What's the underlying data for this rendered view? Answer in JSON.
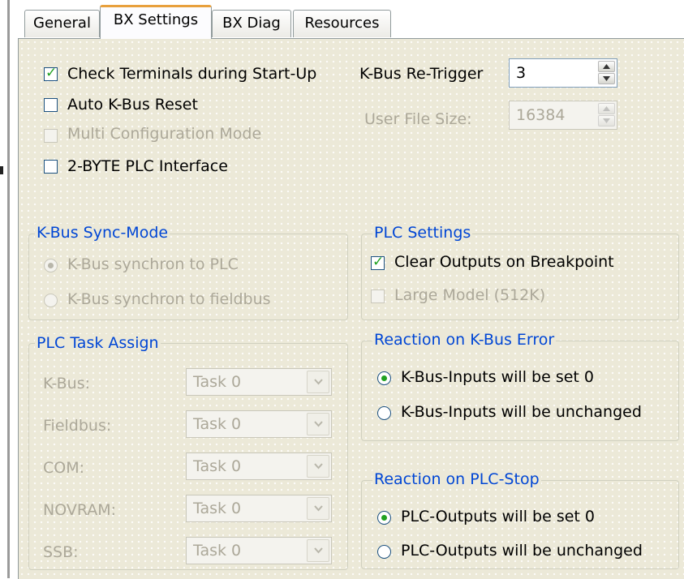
{
  "tabs": [
    "General",
    "BX Settings",
    "BX Diag",
    "Resources"
  ],
  "active_tab": "BX Settings",
  "checkboxes": {
    "check_terminals": {
      "label": "Check Terminals during Start-Up",
      "checked": true,
      "enabled": true
    },
    "auto_kbus_reset": {
      "label": "Auto K-Bus Reset",
      "checked": false,
      "enabled": true
    },
    "multi_config": {
      "label": "Multi Configuration Mode",
      "checked": false,
      "enabled": false
    },
    "two_byte_plc": {
      "label": "2-BYTE PLC Interface",
      "checked": false,
      "enabled": true
    }
  },
  "kbus_retrigger": {
    "label": "K-Bus Re-Trigger",
    "value": "3"
  },
  "user_file_size": {
    "label": "User File Size:",
    "value": "16384"
  },
  "kbus_sync": {
    "title": "K-Bus Sync-Mode",
    "options": [
      "K-Bus synchron to PLC",
      "K-Bus synchron to fieldbus"
    ],
    "selected": 0
  },
  "plc_settings": {
    "title": "PLC Settings",
    "clear_outputs": "Clear Outputs on Breakpoint",
    "large_model": "Large Model (512K)"
  },
  "plc_task_assign": {
    "title": "PLC Task Assign",
    "rows": [
      {
        "label": "K-Bus:",
        "value": "Task 0"
      },
      {
        "label": "Fieldbus:",
        "value": "Task 0"
      },
      {
        "label": "COM:",
        "value": "Task 0"
      },
      {
        "label": "NOVRAM:",
        "value": "Task 0"
      },
      {
        "label": "SSB:",
        "value": "Task 0"
      }
    ]
  },
  "kbus_error": {
    "title": "Reaction on K-Bus Error",
    "options": [
      "K-Bus-Inputs will be set 0",
      "K-Bus-Inputs will be unchanged"
    ],
    "selected": 0
  },
  "plc_stop": {
    "title": "Reaction on PLC-Stop",
    "options": [
      "PLC-Outputs will be set 0",
      "PLC-Outputs will be unchanged"
    ],
    "selected": 0
  },
  "colors": {
    "accent_check": "#21a121",
    "group_title": "#0046d5",
    "disabled_text": "#aca899",
    "tab_highlight": "#e8a03c"
  }
}
